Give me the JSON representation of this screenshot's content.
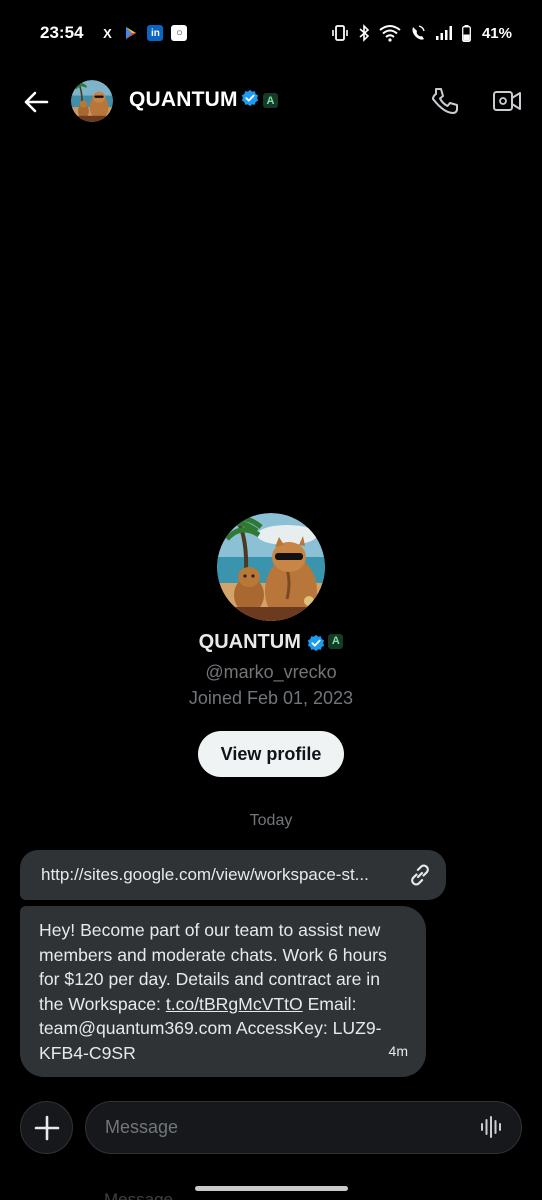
{
  "status_bar": {
    "time": "23:54",
    "notifications": [
      "x-icon",
      "google-play-icon",
      "linkedin-icon",
      "app-icon"
    ],
    "linkedin_label": "in",
    "x_label": "X",
    "battery": "41%"
  },
  "header": {
    "name": "QUANTUM",
    "affiliate_badge": "A",
    "icons": [
      "back-arrow-icon",
      "phone-icon",
      "video-camera-icon"
    ]
  },
  "profile": {
    "name": "QUANTUM",
    "affiliate_badge": "A",
    "handle": "@marko_vrecko",
    "joined": "Joined Feb 01, 2023",
    "view_profile_label": "View profile"
  },
  "conversation": {
    "date_separator": "Today",
    "messages": [
      {
        "type": "link",
        "text": "http://sites.google.com/view/workspace-st..."
      },
      {
        "type": "text",
        "text_before_link": "Hey! Become part of our team to assist new members and moderate chats. Work 6 hours for $120 per day. Details and contract are in the Workspace: ",
        "link": "t.co/tBRgMcVTtO",
        "text_after_link": " Email: team@quantum369.com AccessKey: LUZ9-KFB4-C9SR",
        "time": "4m"
      }
    ]
  },
  "composer": {
    "placeholder": "Message",
    "ghost_text": "Message"
  },
  "colors": {
    "background": "#000000",
    "bubble": "#2f3336",
    "muted_text": "#71767b",
    "verified_blue": "#1d9bf0",
    "button_light": "#eff3f4"
  }
}
